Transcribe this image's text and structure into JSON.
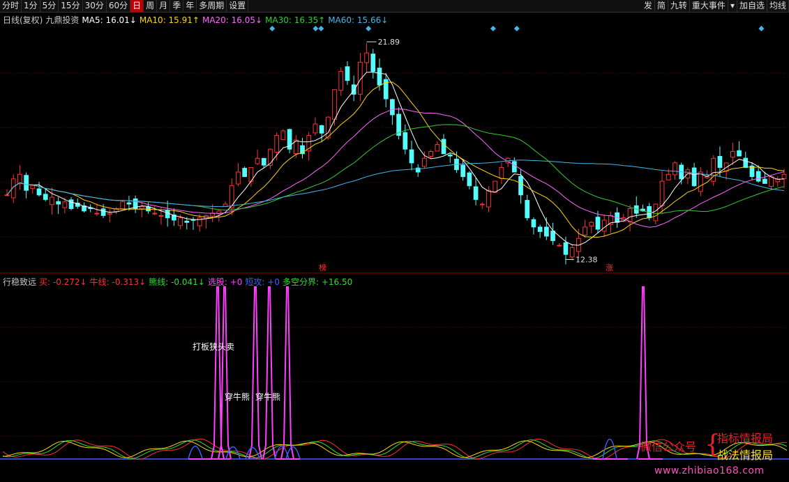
{
  "toolbar": {
    "left": [
      "分时",
      "1分",
      "5分",
      "15分",
      "30分",
      "60分",
      "日",
      "周",
      "月",
      "季",
      "年",
      "多周期",
      "设置"
    ],
    "active": "日",
    "right": [
      "发",
      "简",
      "九转",
      "重大事件",
      "▾",
      "加自选",
      "均线"
    ]
  },
  "main_legend": [
    {
      "text": "日线(复权)",
      "color": "#c8c8c8"
    },
    {
      "text": "九鼎投资",
      "color": "#c8c8c8"
    },
    {
      "text": "MA5: 16.01↓",
      "color": "#ffffff"
    },
    {
      "text": "MA10: 15.91↑",
      "color": "#ffd700"
    },
    {
      "text": "MA20: 16.05↓",
      "color": "#ff66ff"
    },
    {
      "text": "MA30: 16.35↑",
      "color": "#33cc33"
    },
    {
      "text": "MA60: 15.66↓",
      "color": "#45b7e6"
    }
  ],
  "indicator_legend": [
    {
      "text": "行稳致远",
      "color": "#c8c8c8"
    },
    {
      "text": "买: -0.272↓",
      "color": "#ff3030"
    },
    {
      "text": "牛线: -0.313↓",
      "color": "#ff3030"
    },
    {
      "text": "熊线: -0.041↓",
      "color": "#33dd33"
    },
    {
      "text": "选股: +0",
      "color": "#ff40ff"
    },
    {
      "text": "短攻: +0",
      "color": "#4060ff"
    },
    {
      "text": "多空分界: +16.50",
      "color": "#33dd33"
    }
  ],
  "annotations": {
    "high_label": "21.89",
    "low_label": "12.38",
    "marker_bang": "榜",
    "marker_zhang": "涨",
    "ind_text1": "打板狭头卖",
    "ind_text2": "穿牛熊",
    "ind_text3": "穿牛熊"
  },
  "watermark": {
    "wechat": "微信公众号",
    "brand1": "指标情报局",
    "brand2": "战法情报局",
    "url": "www.zhibiao168.com"
  },
  "chart_data": {
    "type": "candlestick",
    "title": "日线(复权) 九鼎投资",
    "ylim": [
      12.0,
      22.5
    ],
    "high": 21.89,
    "low": 12.38,
    "close_series": [
      15.2,
      15.9,
      16.1,
      15.4,
      15.6,
      15.2,
      15.0,
      15.1,
      14.8,
      14.9,
      14.6,
      14.7,
      14.5,
      14.6,
      14.4,
      14.3,
      14.4,
      14.6,
      14.9,
      14.8,
      14.6,
      14.7,
      14.5,
      14.4,
      14.3,
      14.2,
      14.1,
      14.2,
      14.0,
      14.1,
      14.2,
      14.3,
      14.4,
      14.5,
      14.8,
      15.6,
      16.2,
      16.0,
      16.4,
      16.8,
      16.5,
      17.2,
      17.8,
      18.0,
      17.2,
      17.6,
      17.0,
      17.8,
      18.3,
      17.9,
      18.6,
      19.8,
      20.6,
      20.2,
      19.6,
      21.0,
      21.4,
      20.6,
      20.0,
      19.4,
      18.7,
      17.8,
      17.2,
      16.6,
      16.2,
      16.8,
      17.1,
      17.4,
      17.0,
      16.9,
      16.3,
      16.0,
      15.6,
      15.0,
      14.8,
      15.4,
      15.8,
      16.4,
      16.8,
      16.2,
      15.2,
      14.2,
      13.8,
      13.6,
      13.4,
      13.2,
      13.0,
      12.6,
      12.9,
      13.3,
      13.8,
      14.0,
      13.7,
      14.1,
      14.3,
      14.0,
      14.2,
      14.6,
      14.4,
      14.5,
      14.2,
      14.8,
      15.8,
      16.1,
      16.6,
      15.9,
      16.3,
      15.6,
      16.2,
      16.0,
      16.8,
      16.4,
      16.6,
      17.1,
      16.9,
      16.4,
      16.0,
      15.8,
      15.7,
      16.0,
      15.9,
      16.1
    ],
    "ma_series": [
      "MA5",
      "MA10",
      "MA20",
      "MA30",
      "MA60"
    ],
    "ma_values": [
      16.01,
      15.91,
      16.05,
      16.35,
      15.66
    ],
    "indicator": {
      "name": "行稳致远",
      "买": -0.272,
      "牛线": -0.313,
      "熊线": -0.041,
      "选股": 0,
      "短攻": 0,
      "多空分界": 16.5
    },
    "colors": {
      "up": "#ff3333",
      "down": "#54fcfc",
      "ma5": "#ffffff",
      "ma10": "#ffd700",
      "ma20": "#ff66ff",
      "ma30": "#33cc33",
      "ma60": "#45b7e6",
      "select": "#ff40ff",
      "short": "#4060ff"
    }
  }
}
